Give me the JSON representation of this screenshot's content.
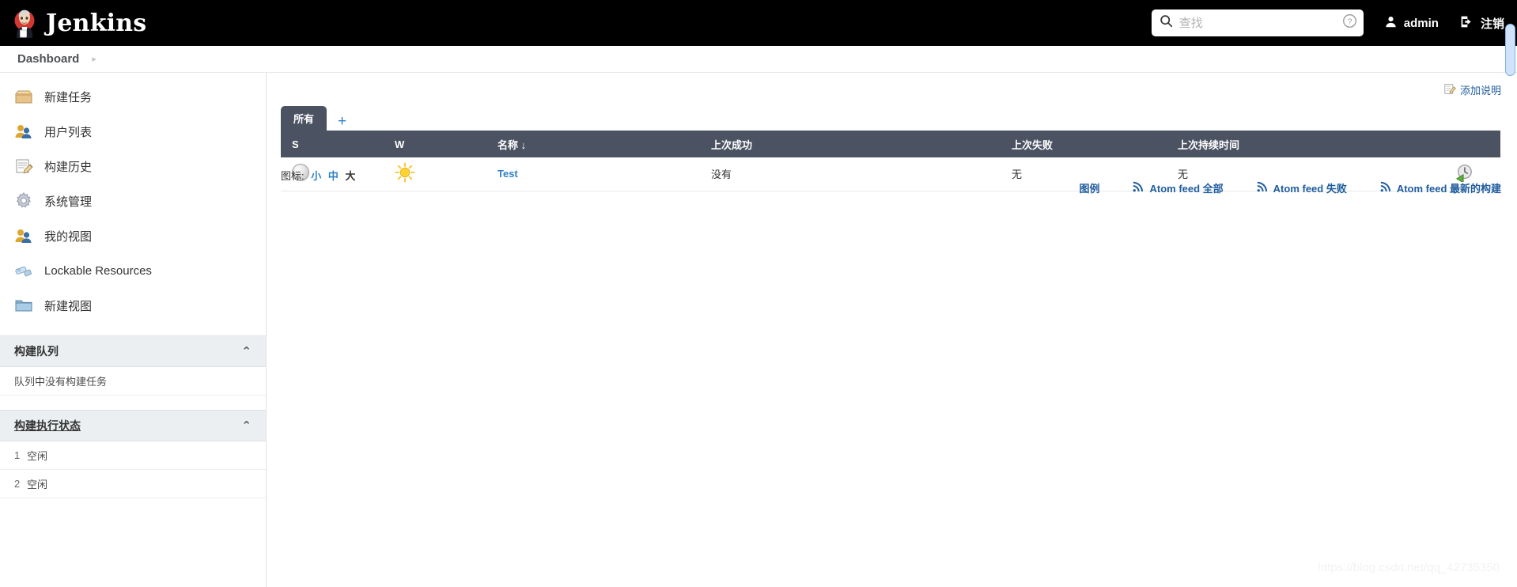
{
  "header": {
    "brand_title": "Jenkins",
    "search_placeholder": "查找",
    "search_value": "",
    "help_icon": "help-circle-icon",
    "search_icon": "search-icon",
    "user_name": "admin",
    "user_icon": "person-icon",
    "logout_label": "注销",
    "logout_icon": "logout-icon",
    "background_color": "#000000"
  },
  "breadcrumb": {
    "items": [
      "Dashboard"
    ],
    "chevron": "▸"
  },
  "sidebar": {
    "items": [
      {
        "label": "新建任务",
        "icon": "new-item-box-icon"
      },
      {
        "label": "用户列表",
        "icon": "people-icon"
      },
      {
        "label": "构建历史",
        "icon": "notepad-pencil-icon"
      },
      {
        "label": "系统管理",
        "icon": "gear-icon"
      },
      {
        "label": "我的视图",
        "icon": "people-icon"
      },
      {
        "label": "Lockable Resources",
        "icon": "lock-resource-icon"
      },
      {
        "label": "新建视图",
        "icon": "folder-icon"
      }
    ],
    "build_queue": {
      "title": "构建队列",
      "empty_text": "队列中没有构建任务",
      "caret": "⌃"
    },
    "build_executor": {
      "title": "构建执行状态",
      "caret": "⌃",
      "executors": [
        {
          "index": "1",
          "status": "空闲"
        },
        {
          "index": "2",
          "status": "空闲"
        }
      ]
    }
  },
  "main": {
    "add_description": {
      "label": "添加说明",
      "icon": "edit-note-icon"
    },
    "tabs": [
      {
        "label": "所有",
        "active": true
      }
    ],
    "add_tab_label": "+",
    "table": {
      "columns": [
        "S",
        "W",
        "名称 ↓",
        "上次成功",
        "上次失败",
        "上次持续时间",
        ""
      ],
      "rows": [
        {
          "status_icon": "grey-ball-not-built-icon",
          "weather_icon": "sunny-weather-icon",
          "name": "Test",
          "last_success": "没有",
          "last_failure": "无",
          "last_duration": "无",
          "action_icon": "schedule-build-icon"
        }
      ]
    },
    "icon_size": {
      "label": "图标:",
      "options": [
        {
          "label": "小",
          "current": false
        },
        {
          "label": "中",
          "current": false
        },
        {
          "label": "大",
          "current": true
        }
      ]
    },
    "legend_label": "图例",
    "feeds": [
      {
        "label": "Atom feed 全部",
        "icon": "rss-icon"
      },
      {
        "label": "Atom feed 失败",
        "icon": "rss-icon"
      },
      {
        "label": "Atom feed 最新的构建",
        "icon": "rss-icon"
      }
    ]
  },
  "watermark": "https://blog.csdn.net/qq_42735350",
  "colors": {
    "header_bg": "#000000",
    "table_header_bg": "#4b5363",
    "link_blue": "#2f81c7",
    "feed_blue": "#1f5c9e"
  }
}
